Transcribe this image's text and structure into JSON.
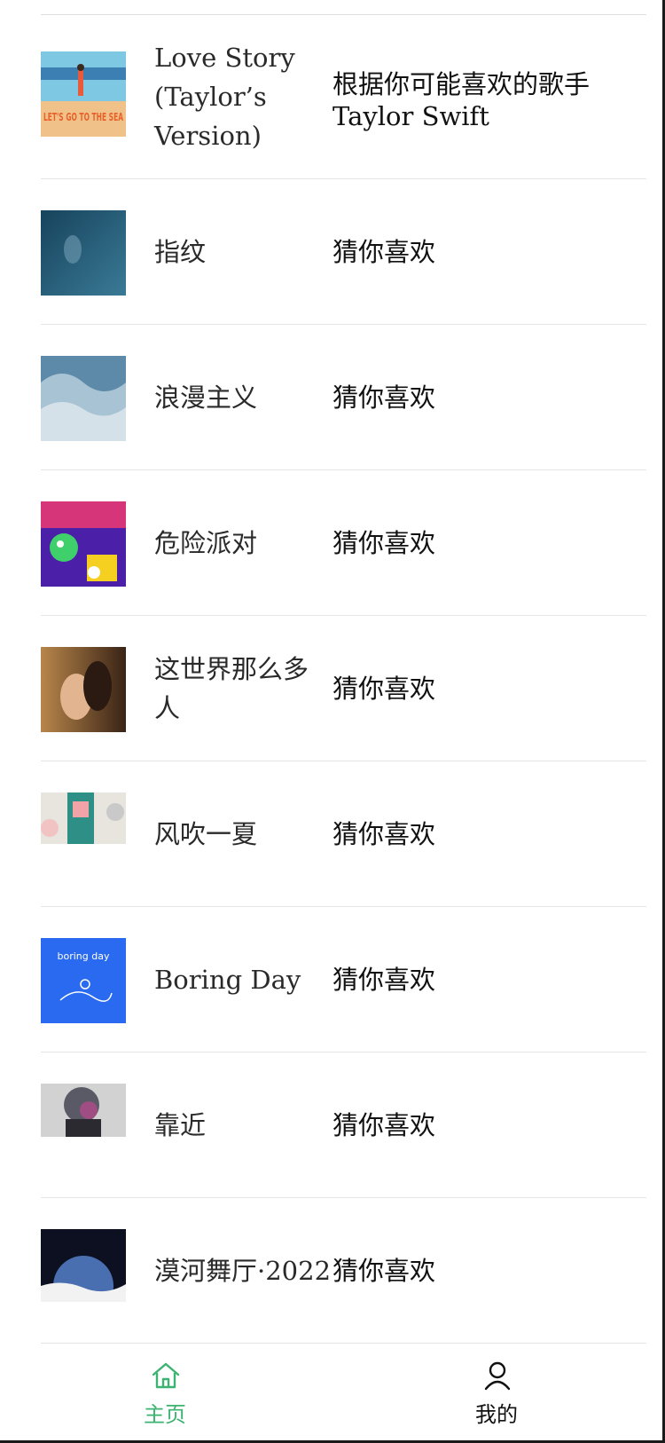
{
  "songs": [
    {
      "title": "Love Story (Taylor’s Version)",
      "reason": "根据你可能喜欢的歌手Taylor Swift",
      "cover": "beach-cover",
      "cover_text": "LET'S GO TO THE SEA"
    },
    {
      "title": "指纹",
      "reason": "猜你喜欢",
      "cover": "deep-sea-cover"
    },
    {
      "title": "浪漫主义",
      "reason": "猜你喜欢",
      "cover": "waves-cover"
    },
    {
      "title": "危险派对",
      "reason": "猜你喜欢",
      "cover": "party-cover"
    },
    {
      "title": "这世界那么多人",
      "reason": "猜你喜欢",
      "cover": "couple-cover"
    },
    {
      "title": "风吹一夏",
      "reason": "猜你喜欢",
      "cover": "summer-cover"
    },
    {
      "title": "Boring Day",
      "reason": "猜你喜欢",
      "cover": "blue-sketch-cover",
      "cover_text": "boring day"
    },
    {
      "title": "靠近",
      "reason": "猜你喜欢",
      "cover": "silhouette-cover"
    },
    {
      "title": "漠河舞厅·2022",
      "reason": "猜你喜欢",
      "cover": "moon-cover"
    }
  ],
  "tabbar": {
    "home": {
      "label": "主页",
      "icon": "home-icon",
      "active": true
    },
    "mine": {
      "label": "我的",
      "icon": "user-icon",
      "active": false
    }
  },
  "colors": {
    "accent": "#3cb371",
    "divider": "#e4e4e4",
    "text": "#222222"
  }
}
